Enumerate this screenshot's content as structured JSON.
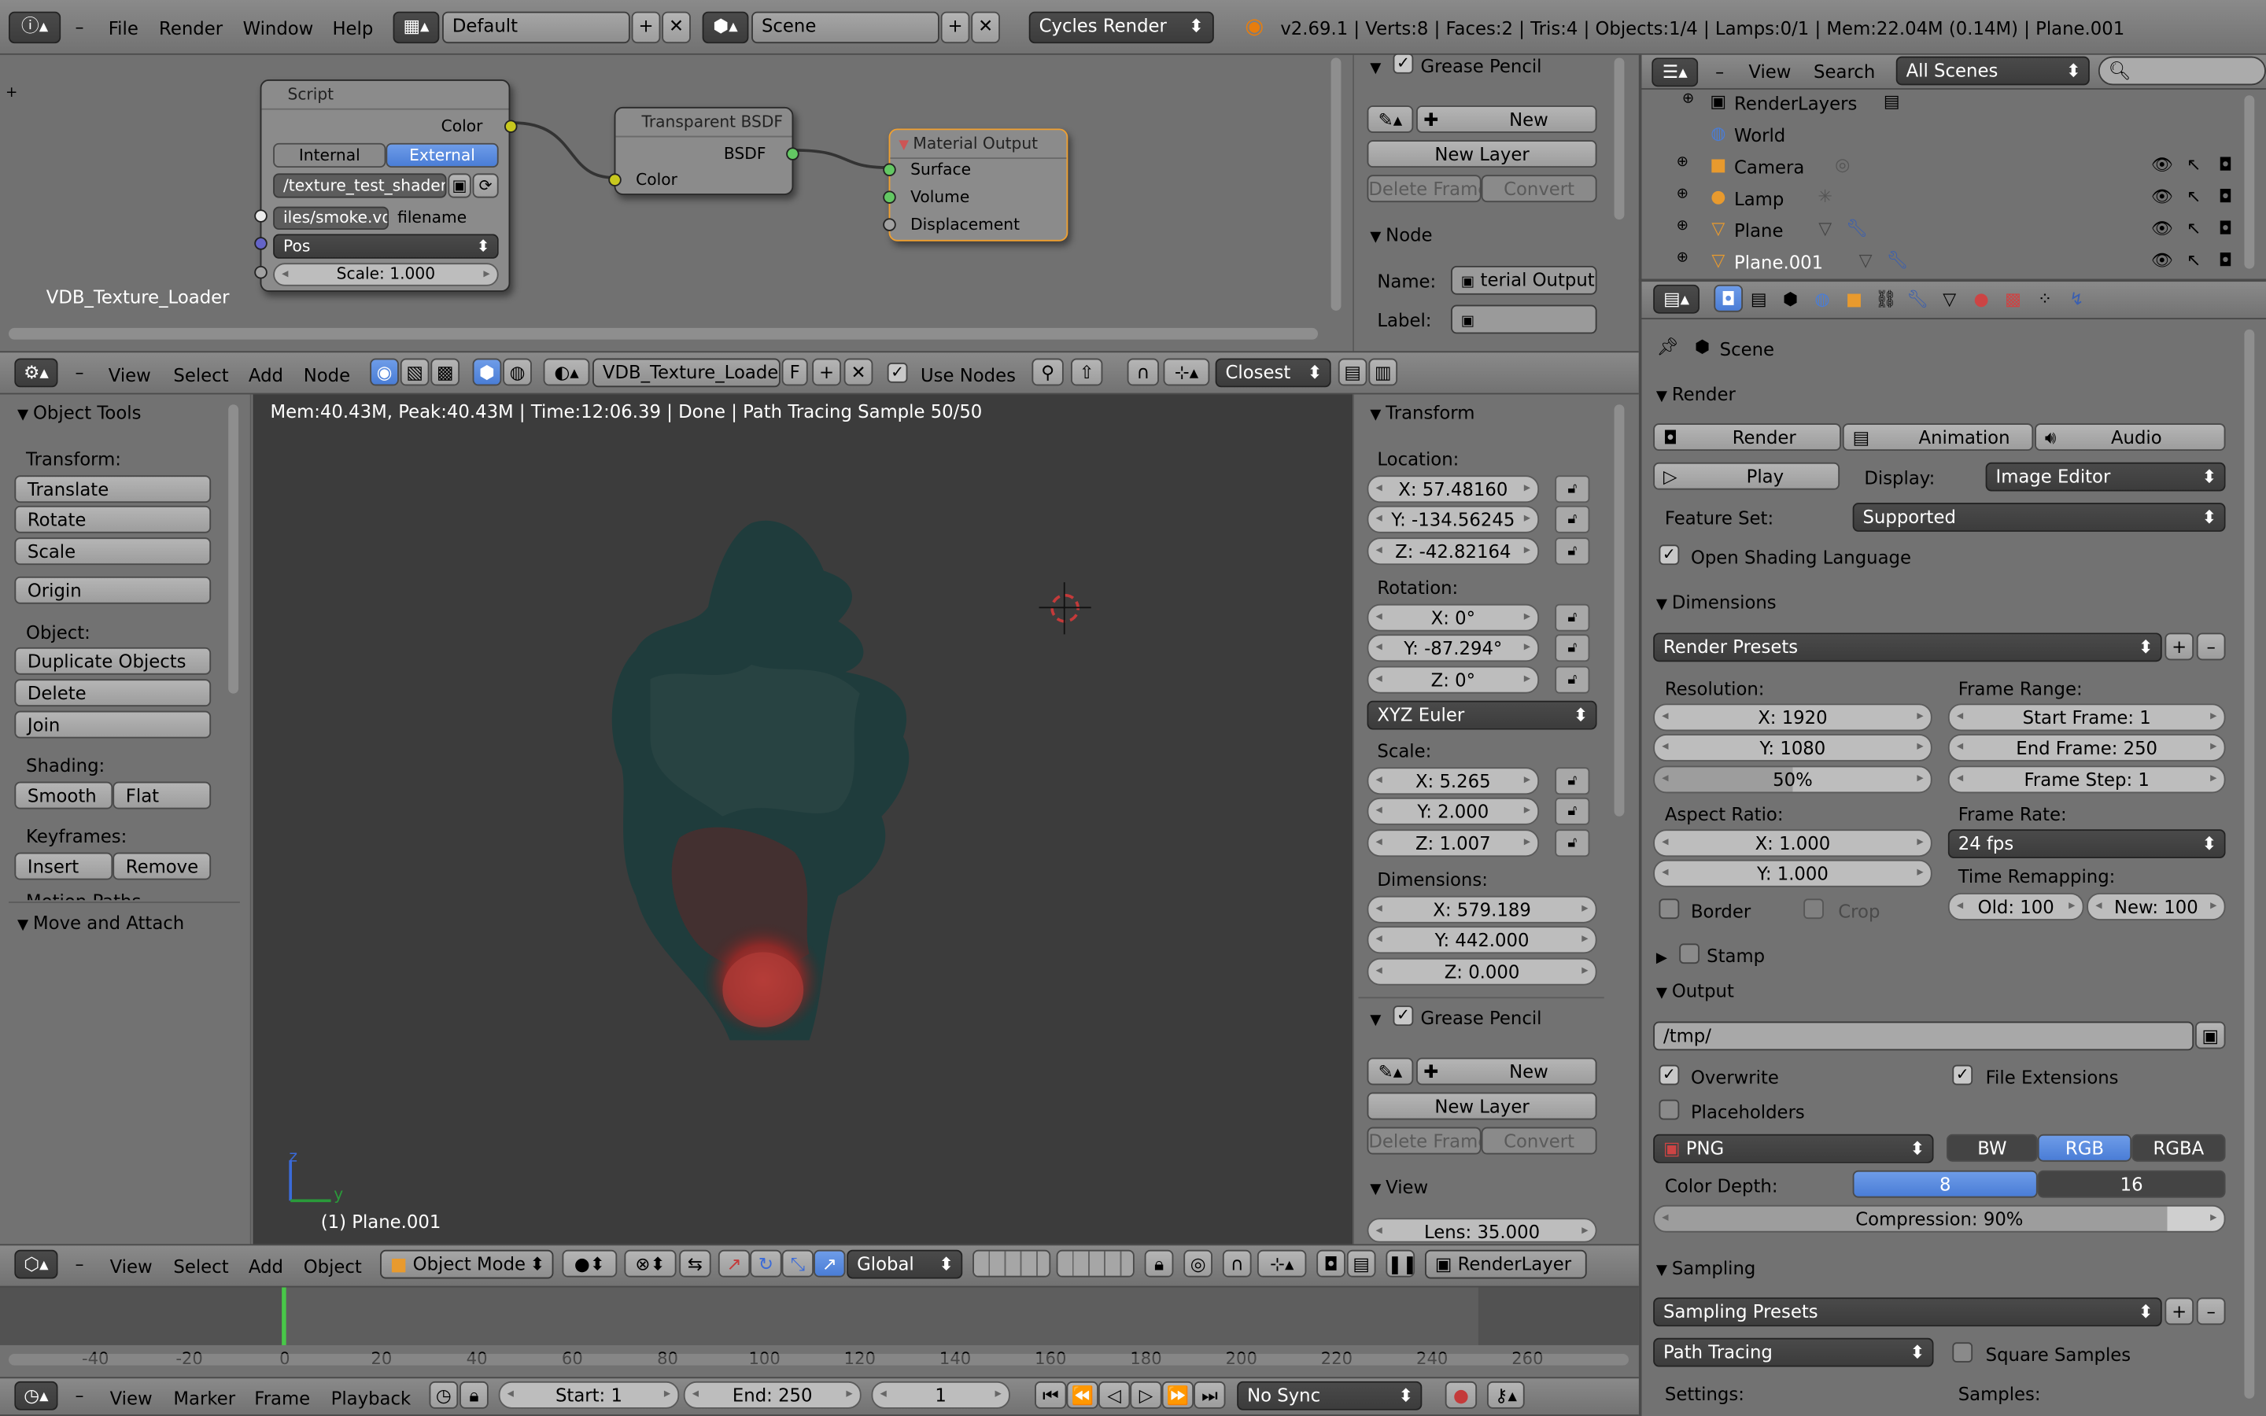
{
  "topbar": {
    "menus": [
      "File",
      "Render",
      "Window",
      "Help"
    ],
    "layout": "Default",
    "scene": "Scene",
    "engine": "Cycles Render",
    "stats": "v2.69.1 | Verts:8 | Faces:2 | Tris:4 | Objects:1/4 | Lamps:0/1 | Mem:22.04M (0.14M) | Plane.001"
  },
  "node_editor": {
    "nodes": {
      "script": {
        "title": "Script",
        "out": "Color",
        "mode_internal": "Internal",
        "mode_external": "External",
        "path": "/texture_test_shader.osl",
        "filename": "iles/smoke.vdb",
        "filename_label": "filename",
        "pos": "Pos",
        "scale": "Scale: 1.000"
      },
      "bsdf": {
        "title": "Transparent BSDF",
        "out": "BSDF",
        "in": "Color"
      },
      "output": {
        "title": "Material Output",
        "surface": "Surface",
        "volume": "Volume",
        "displacement": "Displacement"
      }
    },
    "tree_name": "VDB_Texture_Loader",
    "side": {
      "grease": "Grease Pencil",
      "new": "New",
      "new_layer": "New Layer",
      "delete_frame": "Delete Frame",
      "convert": "Convert",
      "node": "Node",
      "name_label": "Name:",
      "name_value": "terial Output",
      "label_label": "Label:"
    },
    "header": {
      "menus": [
        "View",
        "Select",
        "Add",
        "Node"
      ],
      "tree": "VDB_Texture_Loader",
      "f": "F",
      "use_nodes": "Use Nodes",
      "interp": "Closest"
    }
  },
  "outliner": {
    "menus": [
      "View",
      "Search"
    ],
    "filter": "All Scenes",
    "items": [
      {
        "name": "RenderLayers",
        "color": "#000"
      },
      {
        "name": "World",
        "color": "#000"
      },
      {
        "name": "Camera",
        "color": "#000"
      },
      {
        "name": "Lamp",
        "color": "#000"
      },
      {
        "name": "Plane",
        "color": "#000"
      },
      {
        "name": "Plane.001",
        "color": "#fff"
      }
    ]
  },
  "tools": {
    "title": "Object Tools",
    "transform": "Transform:",
    "translate": "Translate",
    "rotate": "Rotate",
    "scale": "Scale",
    "origin": "Origin",
    "object": "Object:",
    "duplicate": "Duplicate Objects",
    "delete": "Delete",
    "join": "Join",
    "shading": "Shading:",
    "smooth": "Smooth",
    "flat": "Flat",
    "keyframes": "Keyframes:",
    "insert": "Insert",
    "remove": "Remove",
    "motion": "Motion Paths",
    "move_attach": "Move and Attach"
  },
  "viewport": {
    "status": "Mem:40.43M, Peak:40.43M | Time:12:06.39 | Done | Path Tracing Sample 50/50",
    "object_label": "(1) Plane.001",
    "axis_y": "y",
    "axis_z": "z"
  },
  "transform_panel": {
    "title": "Transform",
    "location": "Location:",
    "loc": [
      "X: 57.48160",
      "Y: -134.56245",
      "Z: -42.82164"
    ],
    "rotation": "Rotation:",
    "rot": [
      "X: 0°",
      "Y: -87.294°",
      "Z: 0°"
    ],
    "euler": "XYZ Euler",
    "scale": "Scale:",
    "scl": [
      "X: 5.265",
      "Y: 2.000",
      "Z: 1.007"
    ],
    "dimensions": "Dimensions:",
    "dim": [
      "X: 579.189",
      "Y: 442.000",
      "Z: 0.000"
    ],
    "grease": "Grease Pencil",
    "new": "New",
    "new_layer": "New Layer",
    "delete_frame": "Delete Frame",
    "convert": "Convert",
    "view": "View",
    "lens": "Lens: 35.000"
  },
  "view3d_header": {
    "menus": [
      "View",
      "Select",
      "Add",
      "Object"
    ],
    "mode": "Object Mode",
    "orientation": "Global",
    "layer": "RenderLayer"
  },
  "properties": {
    "context": "Scene",
    "render": {
      "title": "Render",
      "render_btn": "Render",
      "animation": "Animation",
      "audio": "Audio",
      "play": "Play",
      "display_label": "Display:",
      "display": "Image Editor",
      "feature_label": "Feature Set:",
      "feature": "Supported",
      "osl": "Open Shading Language"
    },
    "dimensions": {
      "title": "Dimensions",
      "presets": "Render Presets",
      "resolution": "Resolution:",
      "res_x": "X: 1920",
      "res_y": "Y: 1080",
      "res_pct": "50%",
      "frame_range": "Frame Range:",
      "start": "Start Frame: 1",
      "end": "End Frame: 250",
      "step": "Frame Step: 1",
      "aspect": "Aspect Ratio:",
      "asp_x": "X: 1.000",
      "asp_y": "Y: 1.000",
      "frame_rate": "Frame Rate:",
      "fps": "24 fps",
      "time_remap": "Time Remapping:",
      "old": "Old: 100",
      "new": "New: 100",
      "border": "Border",
      "crop": "Crop"
    },
    "stamp": "Stamp",
    "output": {
      "title": "Output",
      "path": "/tmp/",
      "overwrite": "Overwrite",
      "file_ext": "File Extensions",
      "placeholders": "Placeholders",
      "format": "PNG",
      "bw": "BW",
      "rgb": "RGB",
      "rgba": "RGBA",
      "depth_label": "Color Depth:",
      "d8": "8",
      "d16": "16",
      "compression": "Compression: 90%"
    },
    "sampling": {
      "title": "Sampling",
      "presets": "Sampling Presets",
      "method": "Path Tracing",
      "square": "Square Samples",
      "settings": "Settings:",
      "samples": "Samples:"
    }
  },
  "timeline": {
    "ticks": [
      "-40",
      "-20",
      "0",
      "20",
      "40",
      "60",
      "80",
      "100",
      "120",
      "140",
      "160",
      "180",
      "200",
      "220",
      "240",
      "260"
    ],
    "menus": [
      "View",
      "Marker",
      "Frame",
      "Playback"
    ],
    "start": "Start: 1",
    "end": "End: 250",
    "current": "1",
    "sync": "No Sync"
  }
}
